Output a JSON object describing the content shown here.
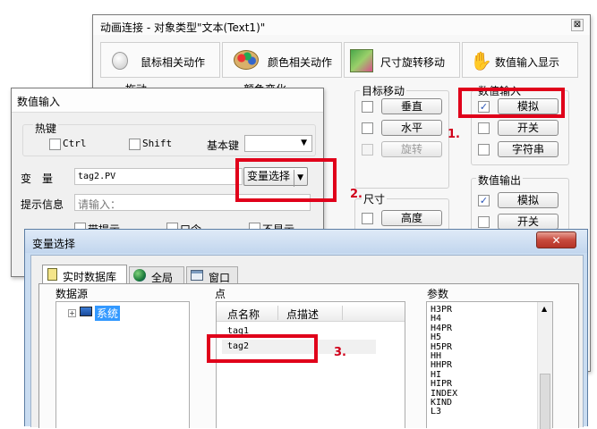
{
  "anim_dialog": {
    "title": "动画连接 - 对象类型\"文本(Text1)\"",
    "close_glyph": "⊠",
    "tabs": [
      "鼠标相关动作",
      "颜色相关动作",
      "尺寸旋转移动",
      "数值输入显示"
    ],
    "mouse_sub": "拖动",
    "color_sub": "颜色变化",
    "move_group": "目标移动",
    "move_buttons": [
      "垂直",
      "水平",
      "旋转"
    ],
    "size_group": "尺寸",
    "size_button": "高度",
    "input_group": "数值输入",
    "input_buttons": [
      "模拟",
      "开关",
      "字符串"
    ],
    "output_group": "数值输出",
    "output_buttons": [
      "模拟",
      "开关"
    ]
  },
  "input_dialog": {
    "title": "数值输入",
    "hotkey_label": "热键",
    "ctrl": "Ctrl",
    "shift": "Shift",
    "basekey_label": "基本键",
    "var_label": "变　量",
    "var_value": "tag2.PV",
    "var_select_button": "变量选择",
    "hint_label": "提示信息",
    "hint_value": "请输入：",
    "option1": "带提示",
    "option2": "口令",
    "option3": "不显示"
  },
  "var_dialog": {
    "title": "变量选择",
    "close_glyph": "✕",
    "tabs": [
      "实时数据库",
      "全局",
      "窗口"
    ],
    "source_label": "数据源",
    "tree_item": "系统",
    "points_label": "点",
    "col_name": "点名称",
    "col_desc": "点描述",
    "points": [
      "tag1",
      "tag2"
    ],
    "params_label": "参数",
    "params": [
      "H3PR",
      "H4",
      "H4PR",
      "H5",
      "H5PR",
      "HH",
      "HHPR",
      "HI",
      "HIPR",
      "INDEX",
      "KIND",
      "L3"
    ]
  },
  "annotations": {
    "step1": "1.",
    "step2": "2.",
    "step3": "3."
  },
  "colors": {
    "accent_red": "#e0001a",
    "title_blue": "#c9dcf1",
    "close_red": "#c74a3d",
    "selection_blue": "#3399ff"
  }
}
